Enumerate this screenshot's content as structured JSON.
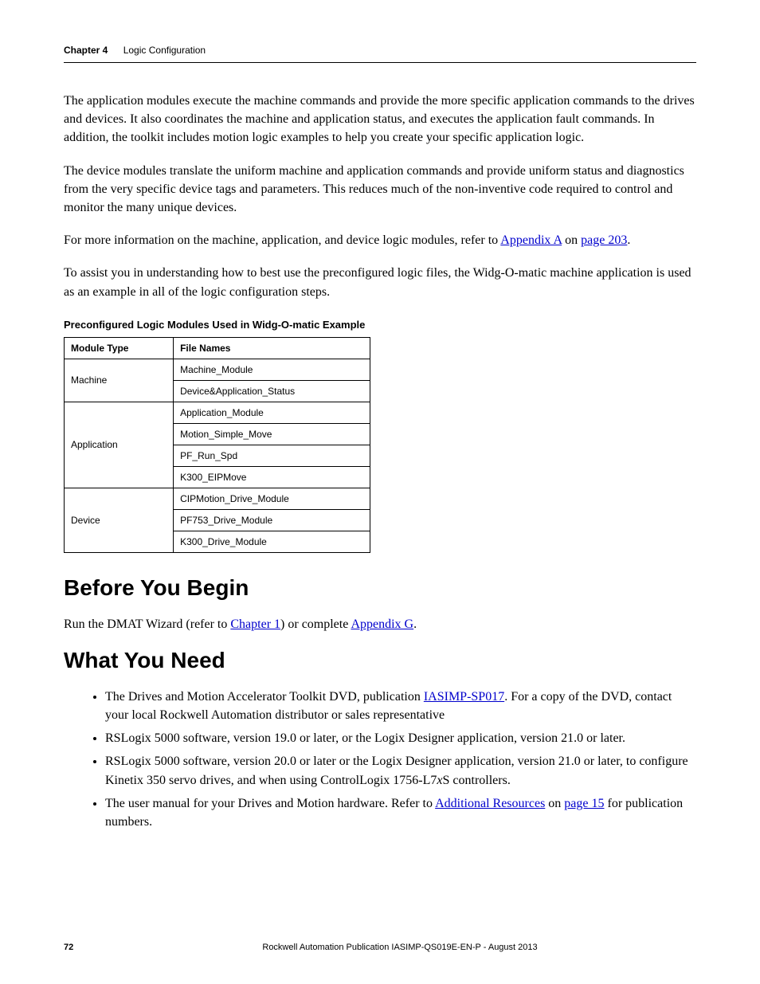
{
  "header": {
    "chapter_label": "Chapter 4",
    "chapter_title": "Logic Configuration"
  },
  "paragraphs": {
    "p1": "The application modules execute the machine commands and provide the more specific application commands to the drives and devices. It also coordinates the machine and application status, and executes the application fault commands. In addition, the toolkit includes motion logic examples to help you create your specific application logic.",
    "p2": "The device modules translate the uniform machine and application commands and provide uniform status and diagnostics from the very specific device tags and parameters. This reduces much of the non-inventive code required to control and monitor the many unique devices.",
    "p3_before": "For more information on the machine, application, and device logic modules, refer to ",
    "p3_link1": "Appendix A",
    "p3_mid": " on ",
    "p3_link2": "page 203",
    "p3_after": ".",
    "p4": "To assist you in understanding how to best use the preconfigured logic files, the Widg-O-matic machine application is used as an example in all of the logic configuration steps."
  },
  "table": {
    "caption": "Preconfigured Logic Modules Used in Widg-O-matic Example",
    "headers": {
      "col1": "Module Type",
      "col2": "File Names"
    },
    "rows": {
      "machine_label": "Machine",
      "machine_files": [
        "Machine_Module",
        "Device&Application_Status"
      ],
      "application_label": "Application",
      "application_files": [
        "Application_Module",
        "Motion_Simple_Move",
        "PF_Run_Spd",
        "K300_EIPMove"
      ],
      "device_label": "Device",
      "device_files": [
        "CIPMotion_Drive_Module",
        "PF753_Drive_Module",
        "K300_Drive_Module"
      ]
    }
  },
  "sections": {
    "before_you_begin": {
      "heading": "Before You Begin",
      "para_before": "Run the DMAT Wizard (refer to ",
      "link1": "Chapter 1",
      "para_mid": ") or complete ",
      "link2": "Appendix G",
      "para_after": "."
    },
    "what_you_need": {
      "heading": "What You Need",
      "items": {
        "i1_before": "The Drives and Motion Accelerator Toolkit DVD, publication ",
        "i1_link": "IASIMP-SP017",
        "i1_after": ". For a copy of the DVD, contact your local Rockwell Automation distributor or sales representative",
        "i2": "RSLogix 5000 software, version 19.0 or later, or the Logix Designer application, version 21.0 or later.",
        "i3_before": "RSLogix 5000 software, version 20.0 or later or the Logix Designer application, version 21.0 or later, to configure Kinetix 350 servo drives, and when using ControlLogix 1756-L7",
        "i3_italic": "x",
        "i3_after": "S controllers.",
        "i4_before": "The user manual for your Drives and Motion hardware. Refer to ",
        "i4_link1": "Additional Resources",
        "i4_mid": " on ",
        "i4_link2": "page 15",
        "i4_after": " for publication numbers."
      }
    }
  },
  "footer": {
    "page_number": "72",
    "publication": "Rockwell Automation Publication IASIMP-QS019E-EN-P - August 2013"
  }
}
